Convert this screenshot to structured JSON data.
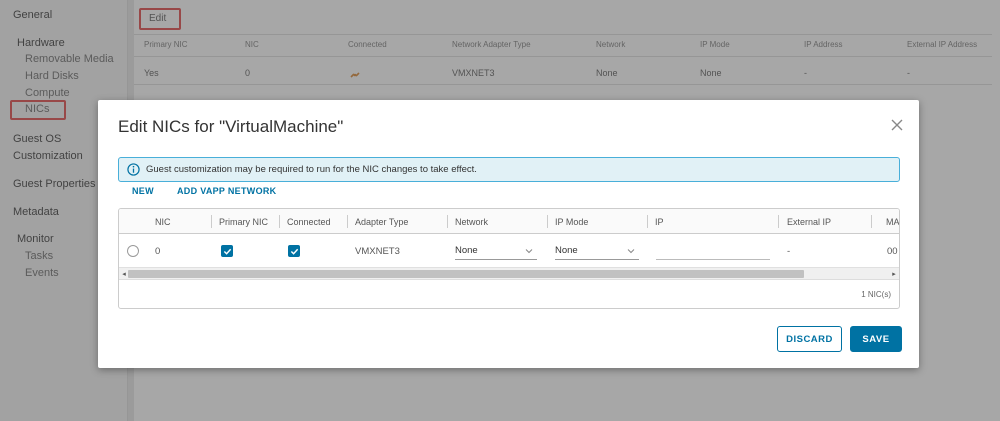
{
  "background": {
    "sidebar": {
      "items": [
        {
          "label": "General",
          "sub": false
        },
        {
          "label": "Hardware",
          "sub": false
        },
        {
          "label": "Removable Media",
          "sub": true
        },
        {
          "label": "Hard Disks",
          "sub": true
        },
        {
          "label": "Compute",
          "sub": true
        },
        {
          "label": "NICs",
          "sub": true
        },
        {
          "label": "Guest OS",
          "sub": false
        },
        {
          "label": "Customization",
          "sub": false
        },
        {
          "label": "Guest Properties",
          "sub": false
        },
        {
          "label": "Metadata",
          "sub": false
        },
        {
          "label": "Monitor",
          "sub": false
        },
        {
          "label": "Tasks",
          "sub": true
        },
        {
          "label": "Events",
          "sub": true
        }
      ]
    },
    "edit_label": "Edit",
    "table": {
      "headers": [
        "Primary NIC",
        "NIC",
        "Connected",
        "Network Adapter Type",
        "Network",
        "IP Mode",
        "IP Address",
        "External IP Address"
      ],
      "row": [
        "Yes",
        "0",
        "",
        "VMXNET3",
        "None",
        "None",
        "-",
        "-"
      ]
    }
  },
  "modal": {
    "title": "Edit NICs for \"VirtualMachine\"",
    "alert": "Guest customization may be required to run for the NIC changes to take effect.",
    "actions": {
      "new": "NEW",
      "add_vapp": "ADD VAPP NETWORK"
    },
    "columns": [
      "NIC",
      "Primary NIC",
      "Connected",
      "Adapter Type",
      "Network",
      "IP Mode",
      "IP",
      "External IP",
      "MA"
    ],
    "row": {
      "nic": "0",
      "primary": true,
      "connected": true,
      "adapter_type": "VMXNET3",
      "network": "None",
      "ip_mode": "None",
      "ip": "",
      "external_ip": "-",
      "mac_partial": "00"
    },
    "footer_count": "1 NIC(s)",
    "buttons": {
      "discard": "DISCARD",
      "save": "SAVE"
    }
  },
  "colors": {
    "accent": "#0072a3",
    "alert_bg": "#e1f1f6",
    "alert_border": "#49afd9",
    "highlight": "#e04040"
  }
}
